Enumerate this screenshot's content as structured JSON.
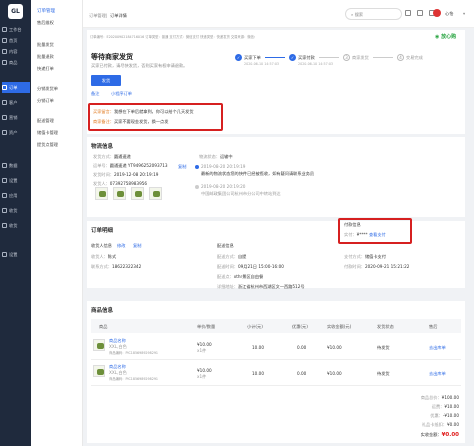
{
  "sidebar": {
    "logo": "GL",
    "items": [
      {
        "label": "工作台",
        "icon": "home-icon"
      },
      {
        "label": "首页",
        "icon": "shop-icon"
      },
      {
        "label": "内容",
        "icon": "content-icon"
      },
      {
        "label": "商品",
        "icon": "goods-icon"
      },
      {
        "label": "订单",
        "icon": "order-icon"
      },
      {
        "label": "客户",
        "icon": "customer-icon"
      },
      {
        "label": "营销",
        "icon": "marketing-icon"
      },
      {
        "label": "资产",
        "icon": "asset-icon"
      },
      {
        "label": "数据",
        "icon": "data-icon"
      },
      {
        "label": "设置",
        "icon": "settings-icon"
      },
      {
        "label": "应用",
        "icon": "apps-icon"
      },
      {
        "label": "收货",
        "icon": "receipt-icon"
      },
      {
        "label": "收货",
        "icon": "delivery-icon"
      },
      {
        "label": "设置",
        "icon": "gear-icon"
      }
    ],
    "active_index": 4
  },
  "subnav": {
    "title": "订单管理",
    "items": [
      "售后维权",
      "批量发货",
      "批量退款",
      "快递打单",
      "分销发货单",
      "分销订单",
      "配送管理",
      "储值卡管理",
      "提货点管理"
    ],
    "active_index": 0
  },
  "topbar": {
    "breadcrumb_1": "订单管理",
    "breadcrumb_2": "订单详情",
    "search_placeholder": "搜索",
    "user": "心怡"
  },
  "order": {
    "meta": "订单编号：E20200902184716016 订单类型：普通 支付方式：微信支付 快递类型：快递发货 交易来源：微信小程序",
    "status_badge": "待发货",
    "status_title": "等待商家发货",
    "status_desc": "买家已付款，请尽快发货，否则买家有权申请退款。",
    "ship_button": "发货",
    "note_link": "备注",
    "mark_link": "小程序订单",
    "brand": "放心购",
    "steps": [
      {
        "label": "买家下单",
        "time": "2020-06-10 14:57:03"
      },
      {
        "label": "买家付款",
        "time": "2020-06-10 14:57:03"
      },
      {
        "label": "商家发货"
      },
      {
        "label": "交易完成"
      }
    ],
    "buyer_msg_label": "买家留言：",
    "buyer_msg": "我想在下单后就拿到，你可以给个几天发货",
    "seller_note_label": "商家备注：",
    "seller_note": "买家不要现金发货，换一点发"
  },
  "logistics": {
    "title": "物流信息",
    "left": [
      {
        "label": "发货方式：",
        "value": "圆通速递"
      },
      {
        "label": "运单号：",
        "value": "圆通速递 YT9496252093713"
      },
      {
        "label": "发货时间：",
        "value": "2019-12-08 20:19:19"
      },
      {
        "label": "发货人：",
        "value": "07392758983956"
      }
    ],
    "copy_link": "复制",
    "status_label": "物流状态：",
    "status_value": "运输中",
    "events": [
      {
        "time": "2019-08-20 20:19:19",
        "text": "最新的物流状态您的快件已经被揽收，如有疑问请联系业务员"
      },
      {
        "time": "2019-08-20 20:19:20",
        "text": "中国邮政集团公司杭州市分公司中转站到达"
      }
    ]
  },
  "detail": {
    "title": "订单明细",
    "buyer_col": {
      "title": "收货人信息",
      "modify_link": "修改",
      "copy_link": "复制",
      "rows": [
        {
          "label": "收货人：",
          "value": "陈式"
        },
        {
          "label": "联系方式：",
          "value": "18622322342"
        }
      ]
    },
    "delivery_col": {
      "title": "配送信息",
      "rows": [
        {
          "label": "配送方式：",
          "value": "自提"
        },
        {
          "label": "配送时间：",
          "value": "09月21日 15:00-16:00"
        },
        {
          "label": "配送点：",
          "value": "xthr景区自由餐"
        },
        {
          "label": "详细地址：",
          "value": "浙江省杭州市西湖区文一西路512号"
        }
      ]
    },
    "pay_col": {
      "title": "付款信息",
      "pay_label": "实付：",
      "pay_value": "¥****",
      "pay_link": "查看支付",
      "rows": [
        {
          "label": "支付方式：",
          "value": "储值卡支付"
        },
        {
          "label": "付款时间：",
          "value": "2020-09-21 15:21:22"
        }
      ]
    }
  },
  "goods": {
    "title": "商品信息",
    "headers": [
      "商品",
      "单价/数量",
      "小计(元)",
      "优惠(元)",
      "实收金额(元)",
      "发货状态",
      "售后"
    ],
    "rows": [
      {
        "name": "商品名称",
        "spec": "XXL,白色",
        "code": "商品编码：PIC1856989298291",
        "price": "¥10.00",
        "qty": "x1件",
        "subtotal": "10.00",
        "discount": "0.00",
        "paid": "¥10.00",
        "status": "待发货",
        "action": "去出库单"
      },
      {
        "name": "商品名称",
        "spec": "XXL,白色",
        "code": "商品编码：PIC1856989298291",
        "price": "¥10.00",
        "qty": "x1件",
        "subtotal": "10.00",
        "discount": "0.00",
        "paid": "¥10.00",
        "status": "待发货",
        "action": "去出库单"
      }
    ],
    "summary": [
      {
        "label": "商品总价：",
        "value": "¥100.00"
      },
      {
        "label": "运费：",
        "value": "¥10.00"
      },
      {
        "label": "优惠：",
        "value": "-¥10.00"
      },
      {
        "label": "礼品卡抵扣：",
        "value": "¥0.00"
      }
    ],
    "total_label": "实收金额：",
    "total_value": "¥0.00"
  },
  "colors": {
    "accent": "#2e6be6",
    "highlight": "#d62020",
    "nav_bg": "#1f2a3d"
  }
}
